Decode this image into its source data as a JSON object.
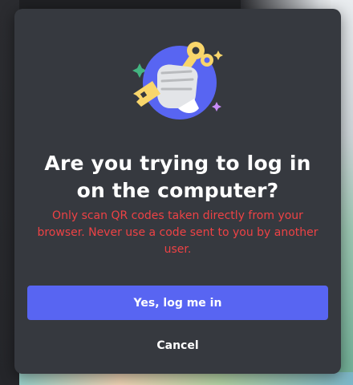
{
  "dialog": {
    "title": "Are you trying to log in on the computer?",
    "warning": "Only scan QR codes taken directly from your browser. Never use a code sent to you by another user.",
    "primary_button_label": "Yes, log me in",
    "cancel_button_label": "Cancel",
    "illustration": "hand-holding-key-icon"
  },
  "colors": {
    "modal_background": "#36393f",
    "title_text": "#ffffff",
    "warning_text": "#ed4245",
    "primary_button": "#5865f2",
    "illustration_circle": "#5865f2",
    "key": "#f9d66b"
  }
}
